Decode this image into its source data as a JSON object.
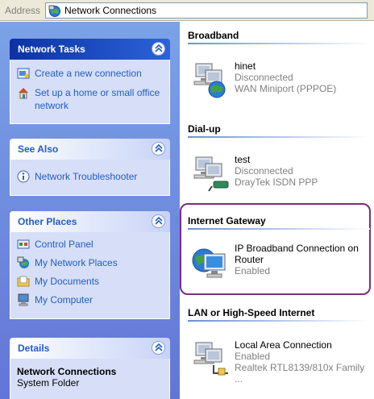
{
  "address": {
    "label": "Address",
    "value": "Network Connections"
  },
  "left_pane": {
    "network_tasks": {
      "title": "Network Tasks",
      "items": [
        {
          "label": "Create a new connection",
          "icon": "new-connection-icon"
        },
        {
          "label": "Set up a home or small office network",
          "icon": "home-network-icon"
        }
      ]
    },
    "see_also": {
      "title": "See Also",
      "items": [
        {
          "label": "Network Troubleshooter",
          "icon": "info-icon"
        }
      ]
    },
    "other_places": {
      "title": "Other Places",
      "items": [
        {
          "label": "Control Panel",
          "icon": "control-panel-icon"
        },
        {
          "label": "My Network Places",
          "icon": "network-places-icon"
        },
        {
          "label": "My Documents",
          "icon": "documents-folder-icon"
        },
        {
          "label": "My Computer",
          "icon": "computer-icon"
        }
      ]
    },
    "details": {
      "title": "Details",
      "name": "Network Connections",
      "type": "System Folder"
    }
  },
  "right_pane": {
    "groups": [
      {
        "title": "Broadband",
        "items": [
          {
            "name": "hinet",
            "status": "Disconnected",
            "device": "WAN Miniport (PPPOE)",
            "icon": "broadband-connection-icon"
          }
        ]
      },
      {
        "title": "Dial-up",
        "items": [
          {
            "name": "test",
            "status": "Disconnected",
            "device": "DrayTek ISDN PPP",
            "icon": "dialup-connection-icon"
          }
        ]
      },
      {
        "title": "Internet Gateway",
        "items": [
          {
            "name_line1": "IP Broadband Connection on",
            "name_line2": "Router",
            "status": "Enabled",
            "icon": "internet-gateway-icon"
          }
        ]
      },
      {
        "title": "LAN or High-Speed Internet",
        "items": [
          {
            "name": "Local Area Connection",
            "status": "Enabled",
            "device": "Realtek RTL8139/810x Family ...",
            "icon": "lan-connection-icon"
          }
        ]
      }
    ]
  },
  "colors": {
    "task_pane_top": "#7ba2e7",
    "task_pane_bottom": "#6375d6",
    "link_blue": "#215dc6",
    "highlight_border": "#7a2e7a"
  }
}
